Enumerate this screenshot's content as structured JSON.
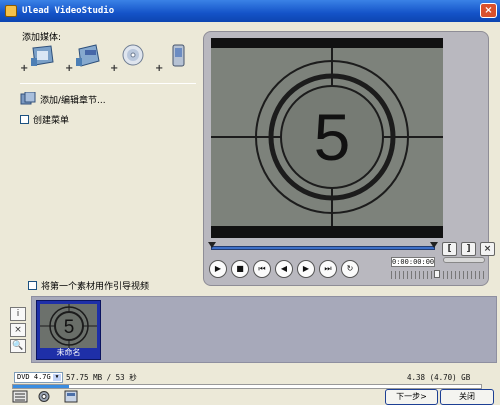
{
  "window": {
    "title": "Ulead VideoStudio",
    "close_glyph": "×"
  },
  "left_panel": {
    "add_media_label": "添加媒体:",
    "media_icons": [
      "video-file-icon",
      "vcd-file-icon",
      "dvd-disc-icon",
      "mobile-device-icon"
    ],
    "plus_glyph": "+",
    "chapter_label": "添加/编辑章节...",
    "create_menu_label": "创建菜单"
  },
  "preview": {
    "countdown_number": "5",
    "timecode": "0:00:00:00",
    "trim_buttons": [
      "[",
      "]",
      "×"
    ],
    "transport_glyphs": [
      "▶",
      "■",
      "⏮",
      "◀",
      "▶",
      "⏭",
      "↻"
    ]
  },
  "media_bin": {
    "first_clip_label": "将第一个素材用作引导视频",
    "tool_glyphs": [
      "i",
      "×",
      "🔍"
    ],
    "clips": [
      {
        "label": "未命名",
        "number": "5"
      }
    ]
  },
  "status": {
    "disc_type": "DVD 4.7G",
    "size_text": "57.75 MB / 53 秒",
    "capacity_text": "4.38 (4.70) GB",
    "capacity_used_fraction": 0.12
  },
  "buttons": {
    "next": "下一步>",
    "close": "关闭"
  }
}
